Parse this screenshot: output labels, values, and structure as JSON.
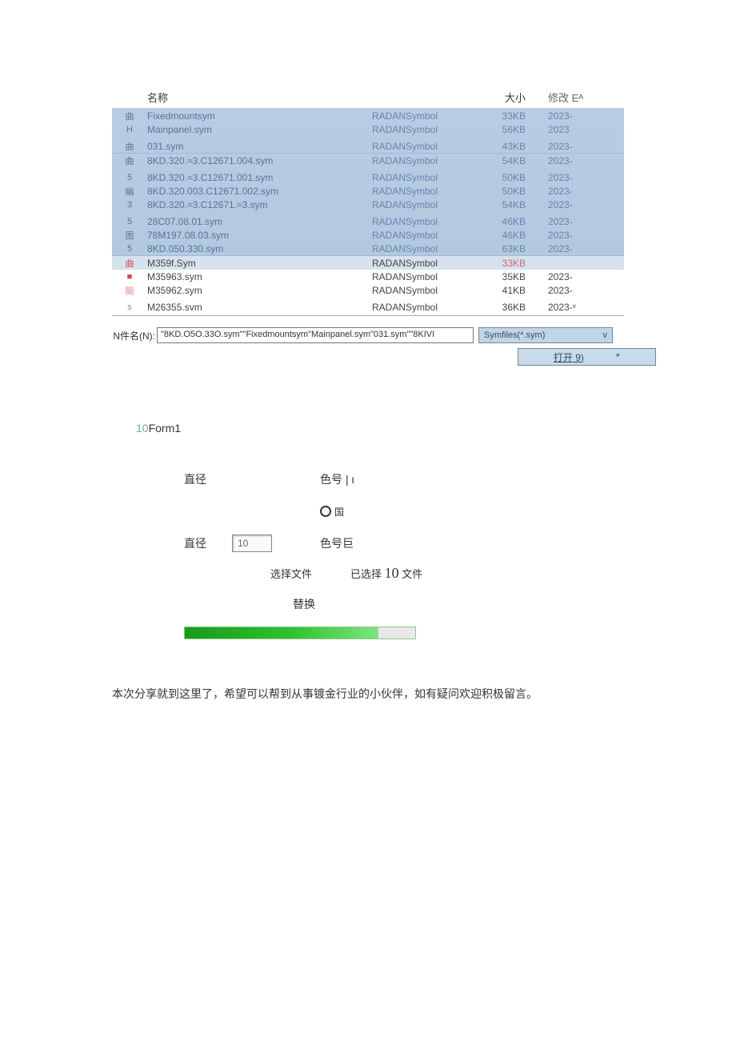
{
  "file_list": {
    "headers": {
      "name": "名称",
      "size": "大小",
      "modified": "修改 Eᴬ"
    },
    "selected_rows": [
      {
        "icon": "曲",
        "name": "Fixedmountsym",
        "type": "RADANSymbol",
        "size": "33KB",
        "date": "2023-"
      },
      {
        "icon": "H",
        "name": "Mainpanel.sym",
        "type": "RADANSymbol",
        "size": "56KB",
        "date": "2023"
      },
      {
        "spacer": true
      },
      {
        "icon": "曲",
        "name": "031.sym",
        "type": "RADANSymbol",
        "size": "43KB",
        "date": "2023-"
      },
      {
        "divider": true
      },
      {
        "icon": "曲",
        "name": "8KD.320.≈3.C12671.004.sym",
        "type": "RADANSymbol",
        "size": "54KB",
        "date": "2023-"
      },
      {
        "spacer": true
      },
      {
        "icon": "5",
        "name": "8KD.320.≈3.C12671.001.sym",
        "type": "RADANSymbol",
        "size": "50KB",
        "date": "2023-"
      },
      {
        "icon": "幽",
        "name": "8KD.320.003.C12671.002.sym",
        "type": "RADANSymbol",
        "size": "50KB",
        "date": "2023-"
      },
      {
        "icon": "3",
        "name": "8KD.320.≈3.C12671.≈3.sym",
        "type": "RADANSymbol",
        "size": "54KB",
        "date": "2023-"
      },
      {
        "spacer": true
      },
      {
        "icon": "5",
        "name": "28C07.08.01.sym",
        "type": "RADANSymbol",
        "size": "46KB",
        "date": "2023-"
      },
      {
        "icon": "图",
        "name": "78M197.08.03.sym",
        "type": "RADANSymbol",
        "size": "46KB",
        "date": "2023-"
      },
      {
        "icon": "5",
        "name": "8KD.050.330.sym",
        "type": "RADANSymbol",
        "size": "63KB",
        "date": "2023-"
      }
    ],
    "hover_row": {
      "icon": "曲",
      "name": "M359f.Sym",
      "type": "RADANSymbol",
      "size": "33KB",
      "date": ""
    },
    "unselected_rows": [
      {
        "icon": "■",
        "iconClass": "red-ico",
        "name": "M35963.sym",
        "type": "RADANSymbol",
        "size": "35KB",
        "date": "2023-"
      },
      {
        "icon": "脑",
        "iconClass": "orange-ico",
        "name": "M35962.sym",
        "type": "RADANSymbol",
        "size": "41KB",
        "date": "2023-"
      },
      {
        "spacer": true
      },
      {
        "icon": "s",
        "iconClass": "green-ico",
        "name": "M26355.svm",
        "type": "RADANSymbol",
        "size": "36KB",
        "date": "2023-ᵛ"
      }
    ]
  },
  "filename_bar": {
    "label": "N件名(N):",
    "value": "\"8KD.O5O.33O.sym\"\"Fixedmountsym\"Mainpanel.sym\"031.sym\"\"8KIVI",
    "filter": "Symfiles(*.sym)",
    "filter_caret": "v",
    "open": "打开 9)",
    "open_mark": "*"
  },
  "form1": {
    "title_prefix": "10",
    "title": "Form1",
    "row1_left": "直径",
    "row1_right_l": "色号",
    "row1_right_r": "| ι",
    "row2_circle_label": "国",
    "row3_left": "直径",
    "row3_box": "10",
    "row3_right": "色号巨",
    "select_file": "选择文件",
    "selected_prefix": "已选择",
    "selected_count": "10",
    "selected_suffix": "文件",
    "replace": "替换"
  },
  "closing_text": "本次分享就到这里了，希望可以帮到从事镀金行业的小伙伴，如有疑问欢迎积极留言。"
}
